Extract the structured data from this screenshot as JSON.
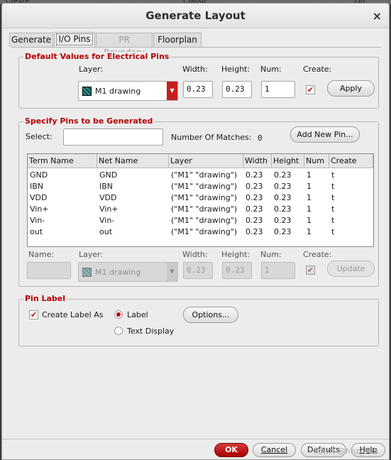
{
  "background": {
    "left_text": "Create",
    "mid_text": "Classic",
    "right_text": "Ott"
  },
  "dialog": {
    "title": "Generate Layout",
    "close_glyph": "×"
  },
  "tabs": [
    {
      "label": "Generate",
      "state": "normal"
    },
    {
      "label": "I/O Pins",
      "state": "active"
    },
    {
      "label": "PR Boundary",
      "state": "disabled"
    },
    {
      "label": "Floorplan",
      "state": "normal"
    }
  ],
  "defaults": {
    "title": "Default Values for Electrical Pins",
    "layer_label": "Layer:",
    "layer_value": "M1 drawing",
    "width_label": "Width:",
    "width_value": "0.23",
    "height_label": "Height:",
    "height_value": "0.23",
    "num_label": "Num:",
    "num_value": "1",
    "create_label": "Create:",
    "create_checked": true,
    "apply_label": "Apply",
    "layer_icon": "layer-swatch-icon",
    "dropdown_icon": "dropdown-arrow-icon"
  },
  "specify": {
    "title": "Specify Pins to be Generated",
    "select_label": "Select:",
    "select_value": "",
    "matches_label": "Number Of Matches:",
    "matches_value": "0",
    "add_label": "Add New Pin...",
    "columns": [
      "Term Name",
      "Net Name",
      "Layer",
      "Width",
      "Height",
      "Num",
      "Create"
    ],
    "rows": [
      [
        "GND",
        "GND",
        "(\"M1\" \"drawing\")",
        "0.23",
        "0.23",
        "1",
        "t"
      ],
      [
        "IBN",
        "IBN",
        "(\"M1\" \"drawing\")",
        "0.23",
        "0.23",
        "1",
        "t"
      ],
      [
        "VDD",
        "VDD",
        "(\"M1\" \"drawing\")",
        "0.23",
        "0.23",
        "1",
        "t"
      ],
      [
        "Vin+",
        "Vin+",
        "(\"M1\" \"drawing\")",
        "0.23",
        "0.23",
        "1",
        "t"
      ],
      [
        "Vin-",
        "Vin-",
        "(\"M1\" \"drawing\")",
        "0.23",
        "0.23",
        "1",
        "t"
      ],
      [
        "out",
        "out",
        "(\"M1\" \"drawing\")",
        "0.23",
        "0.23",
        "1",
        "t"
      ]
    ],
    "edit": {
      "name_label": "Name:",
      "name_value": "",
      "layer_label": "Layer:",
      "layer_value": "M1 drawing",
      "width_label": "Width:",
      "width_value": "0.23",
      "height_label": "Height:",
      "height_value": "0.23",
      "num_label": "Num:",
      "num_value": "1",
      "create_label": "Create:",
      "update_label": "Update"
    }
  },
  "pin_label": {
    "title": "Pin Label",
    "create_label_text": "Create Label As",
    "create_label_checked": true,
    "radio_label": "Label",
    "radio_text_display": "Text Display",
    "options_label": "Options..."
  },
  "footer": {
    "ok": "OK",
    "cancel": "Cancel",
    "defaults": "Defaults",
    "help": "Help"
  },
  "watermark": "CSDN @hhz_365",
  "colors": {
    "accent_red": "#c40000",
    "ok_button": "#c81d1d",
    "title_red": "#b30000"
  }
}
